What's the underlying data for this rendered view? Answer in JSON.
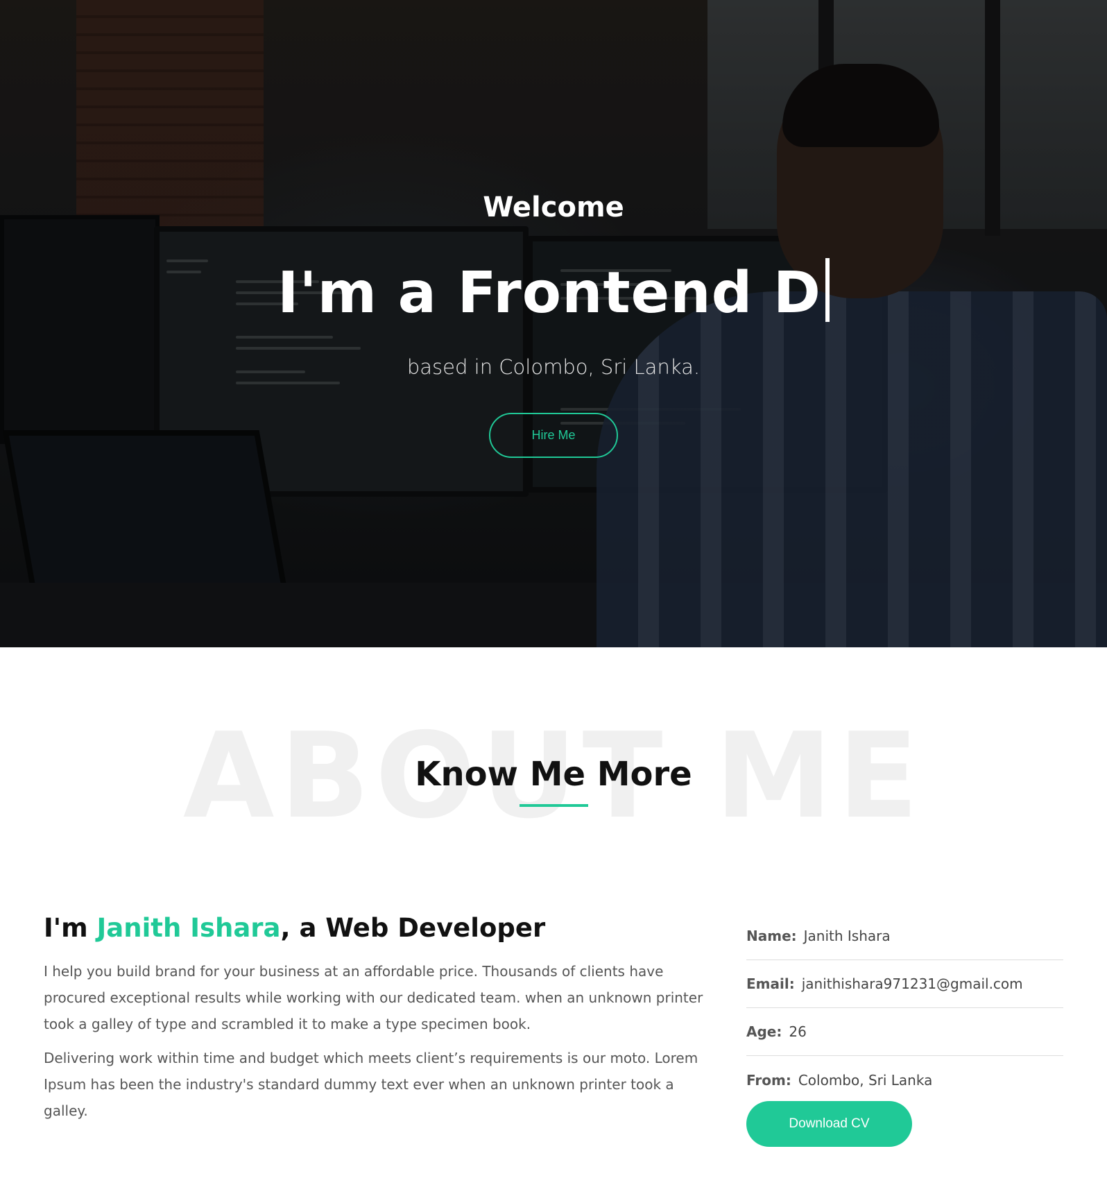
{
  "hero": {
    "welcome": "Welcome",
    "title": "I'm a Frontend D",
    "subtitle": "based in Colombo, Sri Lanka.",
    "hire_button": "Hire Me"
  },
  "about": {
    "bg_text": "ABOUT ME",
    "heading": "Know Me More",
    "intro_prefix": "I'm ",
    "intro_name": "Janith Ishara",
    "intro_suffix": ", a Web Developer",
    "paragraph1": "I help you build brand for your business at an affordable price. Thousands of clients have procured exceptional results while working with our dedicated team. when an unknown printer took a galley of type and scrambled it to make a type specimen book.",
    "paragraph2": "Delivering work within time and budget which meets client’s requirements is our moto. Lorem Ipsum has been the industry's standard dummy text ever when an unknown printer took a galley.",
    "info": [
      {
        "label": "Name:",
        "value": "Janith Ishara"
      },
      {
        "label": "Email:",
        "value": "janithishara971231@gmail.com"
      },
      {
        "label": "Age:",
        "value": "26"
      },
      {
        "label": "From:",
        "value": "Colombo, Sri Lanka"
      }
    ],
    "download_button": "Download CV"
  },
  "colors": {
    "accent": "#20c997",
    "heading": "#111111",
    "body_text": "#555555",
    "watermark": "#f0f0f0"
  }
}
